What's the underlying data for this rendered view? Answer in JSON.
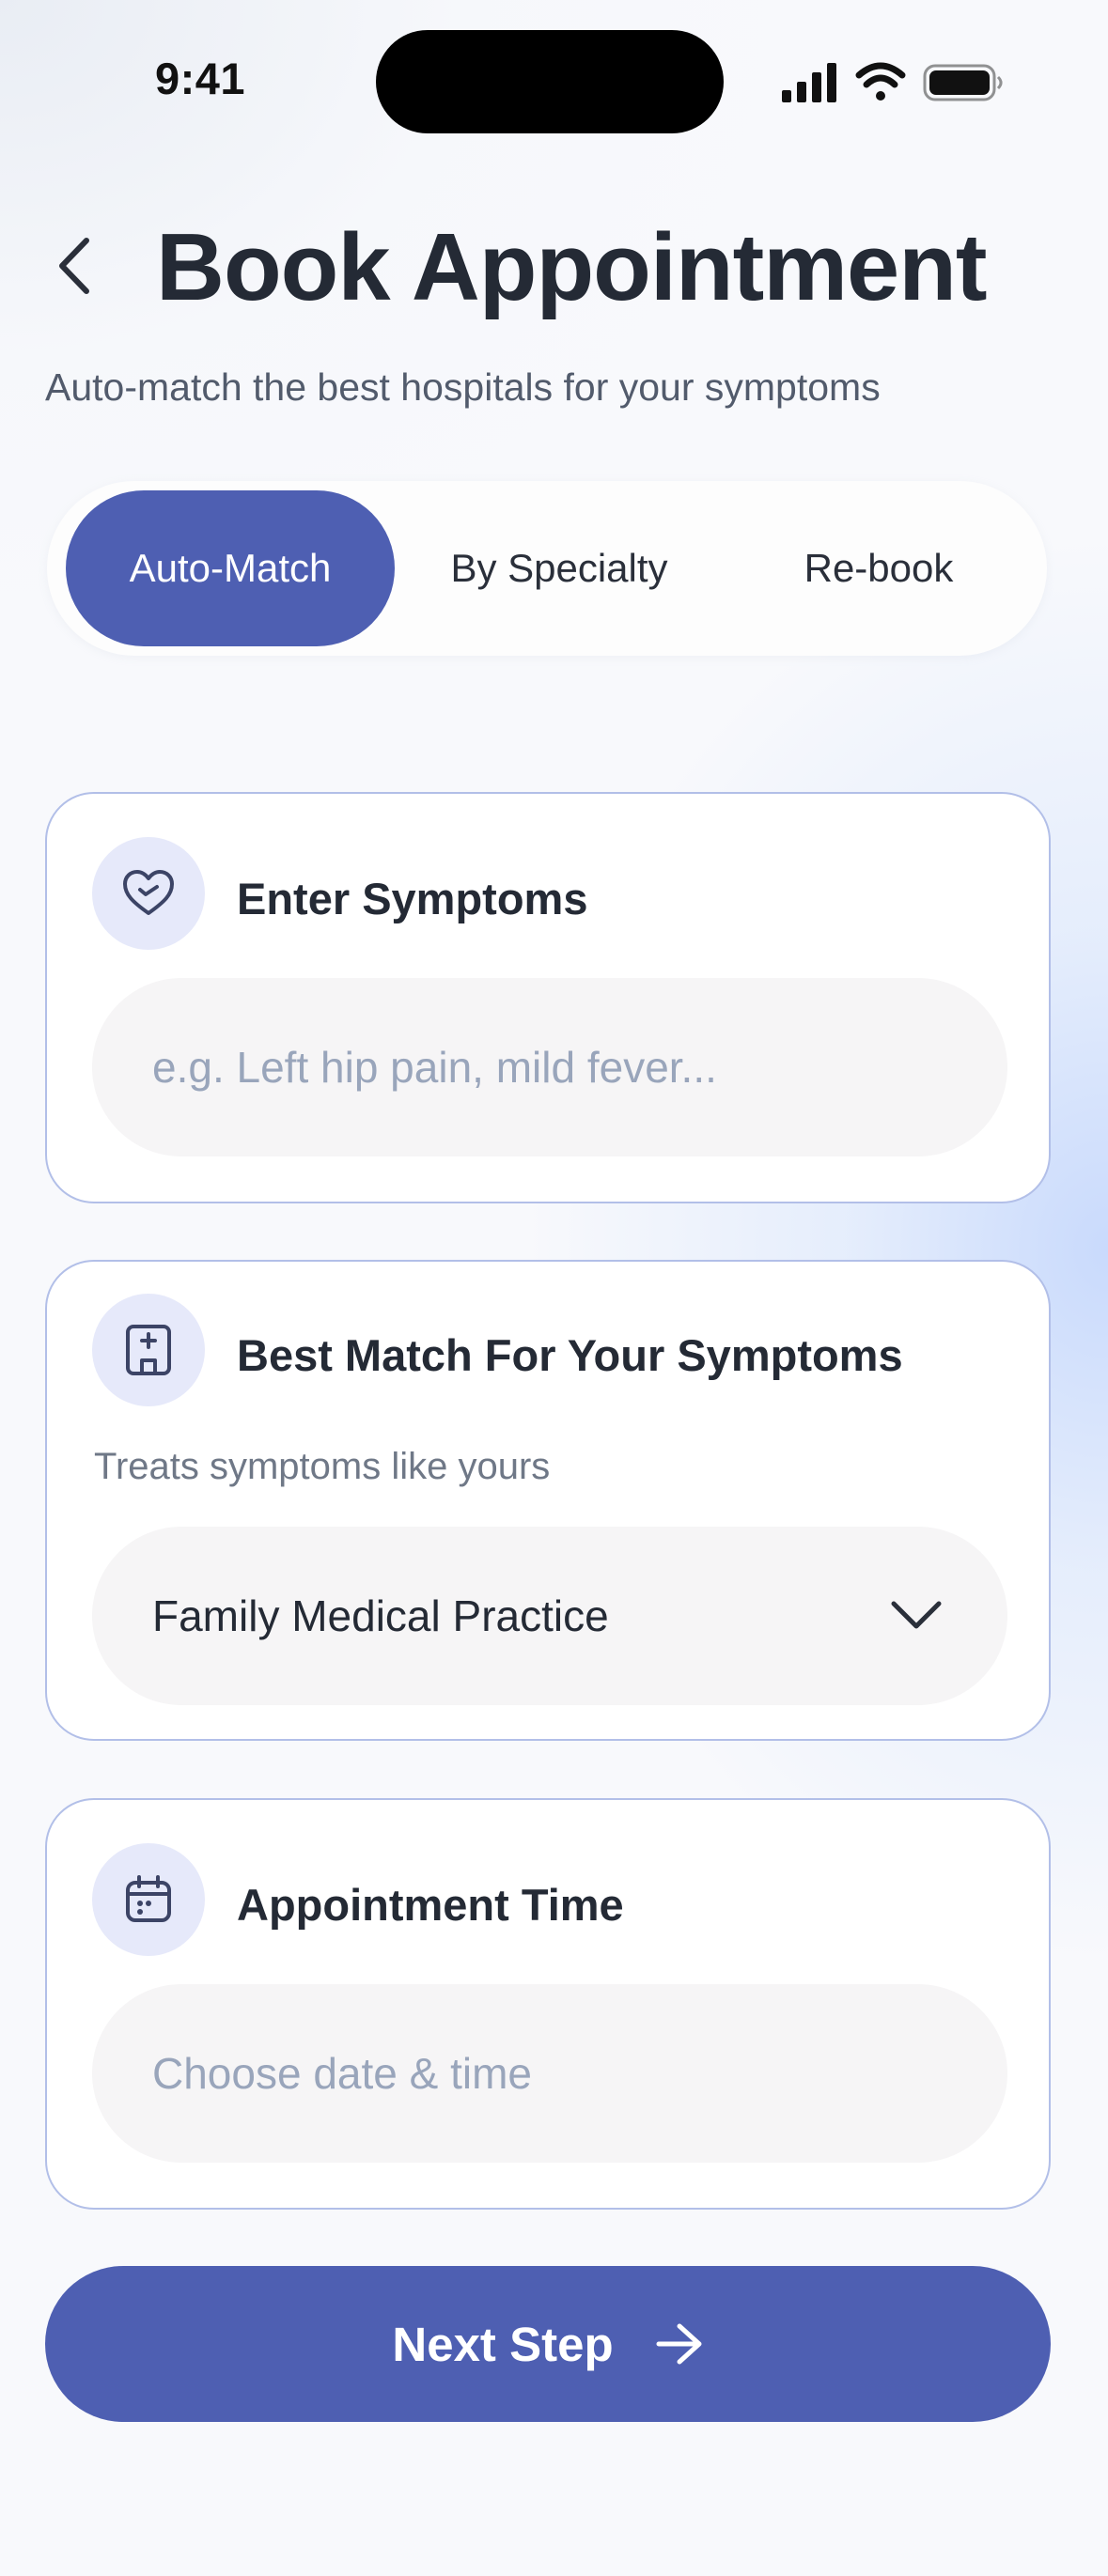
{
  "status_bar": {
    "time": "9:41",
    "icons": [
      "cellular-signal-icon",
      "wifi-icon",
      "battery-icon"
    ]
  },
  "header": {
    "back_icon": "chevron-left-icon",
    "title": "Book Appointment",
    "subtitle": "Auto-match the best hospitals for your symptoms"
  },
  "tabs": [
    {
      "label": "Auto-Match",
      "active": true
    },
    {
      "label": "By Specialty",
      "active": false
    },
    {
      "label": "Re-book",
      "active": false
    }
  ],
  "symptoms": {
    "icon": "heart-hand-icon",
    "title": "Enter Symptoms",
    "placeholder": "e.g. Left hip pain, mild fever...",
    "value": ""
  },
  "best_match": {
    "icon": "hospital-icon",
    "title": "Best Match For Your Symptoms",
    "note": "Treats symptoms like yours",
    "selected": "Family Medical Practice",
    "dropdown_icon": "chevron-down-icon"
  },
  "appointment_time": {
    "icon": "calendar-icon",
    "title": "Appointment Time",
    "placeholder": "Choose date & time",
    "value": ""
  },
  "next_button": {
    "label": "Next Step",
    "icon": "arrow-right-icon"
  },
  "colors": {
    "accent": "#4e5fb2",
    "card_border": "#b2bfe8",
    "icon_bg": "#e6e9fa",
    "field_bg": "#f6f5f6",
    "text_primary": "#242a35",
    "placeholder": "#99a5bb"
  }
}
